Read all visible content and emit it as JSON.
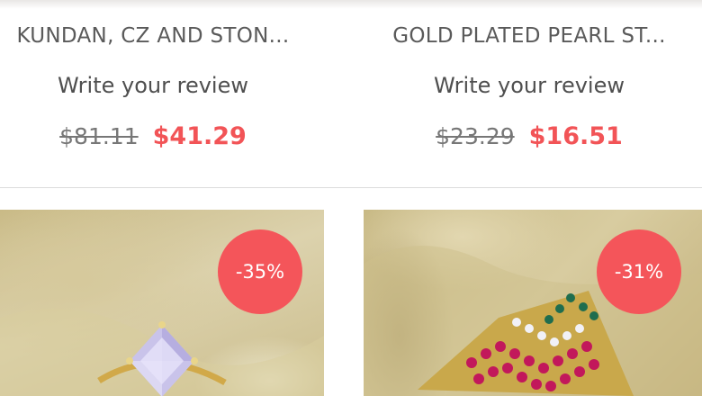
{
  "products_top": [
    {
      "title": "KUNDAN, CZ AND STON...",
      "review_label": "Write your review",
      "old_price": "$81.11",
      "new_price": "$41.29"
    },
    {
      "title": "GOLD PLATED PEARL ST...",
      "review_label": "Write your review",
      "old_price": "$23.29",
      "new_price": "$16.51"
    }
  ],
  "products_bottom": [
    {
      "discount": "-35%",
      "image": "ring-with-lavender-stone"
    },
    {
      "discount": "-31%",
      "image": "multi-band-ring-with-colored-stones"
    }
  ],
  "colors": {
    "sale_price": "#f25457",
    "badge": "#f4555a",
    "old_price": "#777777"
  }
}
